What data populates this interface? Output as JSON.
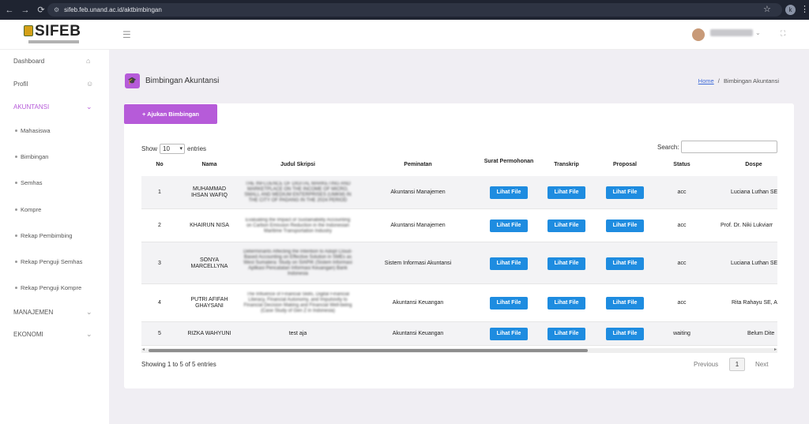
{
  "browser": {
    "url": "sifeb.feb.unand.ac.id/aktbimbingan",
    "profile_initial": "k"
  },
  "app": {
    "logo": "SIFEB",
    "user_name": "Rori Guarisasi"
  },
  "sidebar": {
    "items": [
      {
        "label": "Dashboard",
        "icon": "home-icon"
      },
      {
        "label": "Profil",
        "icon": "user-icon"
      },
      {
        "label": "AKUNTANSI",
        "icon": "chevron-down-icon"
      }
    ],
    "subitems": [
      "Mahasiswa",
      "Bimbingan",
      "Semhas",
      "Kompre",
      "Rekap Pembimbing",
      "Rekap Penguji Semhas",
      "Rekap Penguji Kompre"
    ],
    "sections": [
      {
        "label": "MANAJEMEN",
        "icon": "chevron-down-icon"
      },
      {
        "label": "EKONOMI",
        "icon": "chevron-down-icon"
      }
    ]
  },
  "page": {
    "title": "Bimbingan Akuntansi",
    "breadcrumb_home": "Home",
    "breadcrumb_sep": "/",
    "breadcrumb_current": "Bimbingan Akuntansi",
    "ajukan_button": "+ Ajukan Bimbingan"
  },
  "table_controls": {
    "show_label": "Show",
    "entries_value": "10",
    "entries_label": "entries",
    "search_label": "Search:"
  },
  "table": {
    "headers": [
      "No",
      "Nama",
      "Judul Skripsi",
      "Peminatan",
      "Surat Permohonan",
      "Transkrip",
      "Proposal",
      "Status",
      "Dospe"
    ],
    "rows": [
      {
        "no": "1",
        "nama": "MUHAMMAD IHSAN WAFIQ",
        "judul": "THE INFLUENCE OF DIGITAL MARKETING AND MARKETPLACE ON THE INCOME OF MICRO, SMALL AND MEDIUM ENTERPRISES (UMKM) IN THE CITY OF PADANG IN THE 2024 PERIOD",
        "peminatan": "Akuntansi Manajemen",
        "surat": "Lihat File",
        "transkrip": "Lihat File",
        "proposal": "Lihat File",
        "status": "acc",
        "dospem": "Luciana Luthan SE"
      },
      {
        "no": "2",
        "nama": "KHAIRUN NISA",
        "judul": "Evaluating the Impact of Sustainability Accounting on Carbon Emission Reduction in the Indonesian Maritime Transportation Industry",
        "peminatan": "Akuntansi Manajemen",
        "surat": "Lihat File",
        "transkrip": "Lihat File",
        "proposal": "Lihat File",
        "status": "acc",
        "dospem": "Prof. Dr. Niki Lukviarr"
      },
      {
        "no": "3",
        "nama": "SONYA MARCELLYNA",
        "judul": "Determinants Affecting the Intention to Adopt Cloud-Based Accounting on Effective Solution in SMEs as West Sumatera: Study on SIAPIK (Sistem Informasi Aplikasi Pencatatan Informasi Keuangan) Bank Indonesia",
        "peminatan": "Sistem Informasi Akuntansi",
        "surat": "Lihat File",
        "transkrip": "Lihat File",
        "proposal": "Lihat File",
        "status": "acc",
        "dospem": "Luciana Luthan SE"
      },
      {
        "no": "4",
        "nama": "PUTRI AFIFAH GHAYSANI",
        "judul": "The Influence of Financial Skills, Digital Financial Literacy, Financial Autonomy, and Impulsivity to Financial Decision Making and Financial Well-being (Case Study of Gen Z in Indonesia)",
        "peminatan": "Akuntansi Keuangan",
        "surat": "Lihat File",
        "transkrip": "Lihat File",
        "proposal": "Lihat File",
        "status": "acc",
        "dospem": "Rita Rahayu SE, A"
      },
      {
        "no": "5",
        "nama": "RIZKA WAHYUNI",
        "judul": "test aja",
        "peminatan": "Akuntansi Keuangan",
        "surat": "Lihat File",
        "transkrip": "Lihat File",
        "proposal": "Lihat File",
        "status": "waiting",
        "dospem": "Belum Dite"
      }
    ]
  },
  "footer": {
    "info": "Showing 1 to 5 of 5 entries",
    "previous": "Previous",
    "page": "1",
    "next": "Next"
  },
  "colors": {
    "accent": "#b65bd9",
    "button_blue": "#1e8ce0",
    "link": "#3f6bd8"
  }
}
